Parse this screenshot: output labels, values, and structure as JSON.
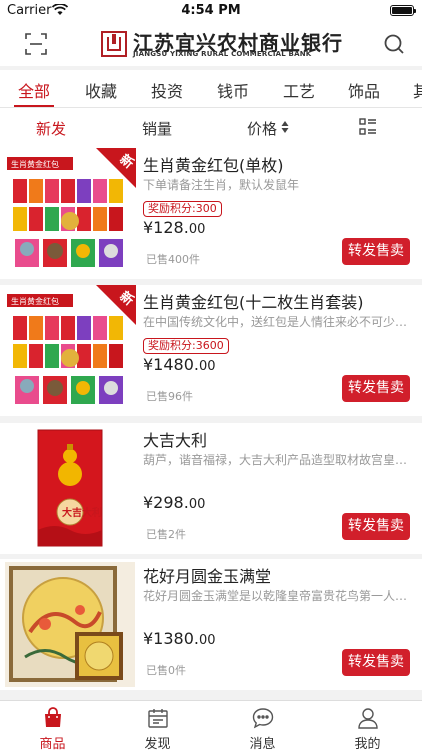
{
  "status": {
    "carrier": "Carrier",
    "time": "4:54 PM"
  },
  "header": {
    "bank_name_cn": "江苏宜兴农村商业银行",
    "bank_name_en": "JIANGSU YIXING RURAL COMMERCIAL BANK",
    "left_icon": "scan-icon",
    "right_icon": "search-icon"
  },
  "categories": [
    "全部",
    "收藏",
    "投资",
    "钱币",
    "工艺",
    "饰品",
    "其"
  ],
  "active_category": "全部",
  "sort": {
    "newest": "新发",
    "sales": "销量",
    "price": "价格",
    "active": "新发"
  },
  "products": [
    {
      "name": "生肖黄金红包(单枚)",
      "desc": "下单请备注生肖，默认发鼠年",
      "points": "奖励积分:300",
      "price_main": "¥128.",
      "price_cents": "00",
      "sold": "已售400件",
      "badge": "新",
      "image_label": "生肖黄金红包",
      "button": "转发售卖"
    },
    {
      "name": "生肖黄金红包(十二枚生肖套装)",
      "desc": "在中国传统文化中，送红包是人情往来必不可少的礼仪",
      "points": "奖励积分:3600",
      "price_main": "¥1480.",
      "price_cents": "00",
      "sold": "已售96件",
      "badge": "新",
      "image_label": "生肖黄金红包",
      "button": "转发售卖"
    },
    {
      "name": "大吉大利",
      "desc": "葫芦，谐音福禄，大吉大利产品造型取材故宫皇家藏品",
      "points": "",
      "price_main": "¥298.",
      "price_cents": "00",
      "sold": "已售2件",
      "badge": "",
      "image_label": "大吉大利",
      "button": "转发售卖"
    },
    {
      "name": "花好月圆金玉满堂",
      "desc": "花好月圆金玉满堂是以乾隆皇帝富贵花鸟第一人之作",
      "points": "",
      "price_main": "¥1380.",
      "price_cents": "00",
      "sold": "已售0件",
      "badge": "",
      "image_label": "",
      "button": "转发售卖"
    }
  ],
  "tabbar": [
    {
      "label": "商品",
      "icon": "bag-icon",
      "active": true
    },
    {
      "label": "发现",
      "icon": "calendar-icon",
      "active": false
    },
    {
      "label": "消息",
      "icon": "message-icon",
      "active": false
    },
    {
      "label": "我的",
      "icon": "person-icon",
      "active": false
    }
  ],
  "colors": {
    "accent": "#c8161d",
    "button": "#d11f2b"
  }
}
